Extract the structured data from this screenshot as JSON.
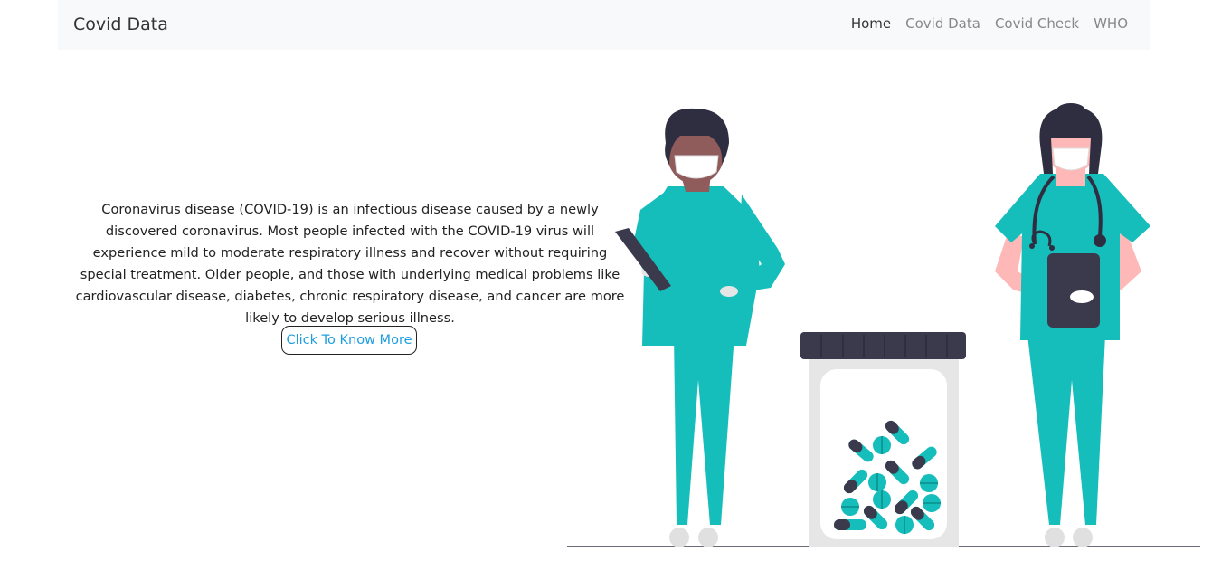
{
  "navbar": {
    "brand": "Covid Data",
    "links": [
      {
        "label": "Home",
        "active": true
      },
      {
        "label": "Covid Data",
        "active": false
      },
      {
        "label": "Covid Check",
        "active": false
      },
      {
        "label": "WHO",
        "active": false
      }
    ]
  },
  "intro": {
    "text": "Coronavirus disease (COVID-19) is an infectious disease caused by a newly discovered coronavirus. Most people infected with the COVID-19 virus will experience mild to moderate respiratory illness and recover without requiring special treatment. Older people, and those with underlying medical problems like cardiovascular disease, diabetes, chronic respiratory disease, and cancer are more likely to develop serious illness.",
    "button_label": "Click To Know More"
  },
  "colors": {
    "teal": "#15bdbb",
    "dark": "#3b3a4c",
    "link": "#1e9ee0"
  }
}
